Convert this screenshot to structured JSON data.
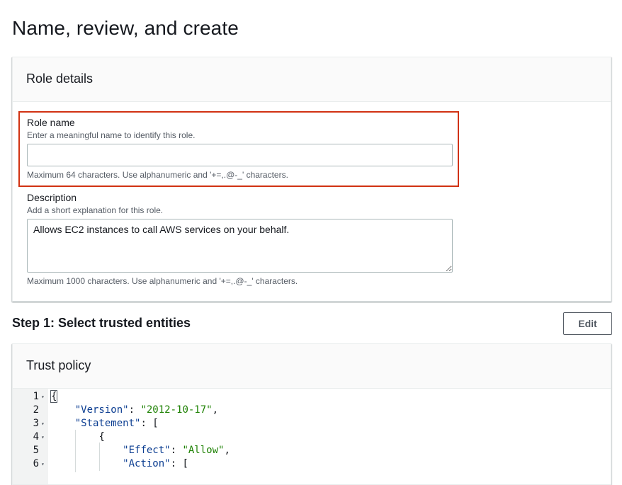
{
  "page": {
    "title": "Name, review, and create"
  },
  "role_details": {
    "header": "Role details",
    "role_name": {
      "label": "Role name",
      "description": "Enter a meaningful name to identify this role.",
      "value": "",
      "constraint": "Maximum 64 characters. Use alphanumeric and '+=,.@-_' characters."
    },
    "description": {
      "label": "Description",
      "description": "Add a short explanation for this role.",
      "value": "Allows EC2 instances to call AWS services on your behalf.",
      "constraint": "Maximum 1000 characters. Use alphanumeric and '+=,.@-_' characters."
    }
  },
  "step1": {
    "title": "Step 1: Select trusted entities",
    "edit_label": "Edit",
    "trust_policy": {
      "header": "Trust policy",
      "lines": [
        {
          "num": "1",
          "foldable": true,
          "text": "{"
        },
        {
          "num": "2",
          "foldable": false,
          "key": "\"Version\"",
          "sep": ": ",
          "val": "\"2012-10-17\"",
          "end": ","
        },
        {
          "num": "3",
          "foldable": true,
          "key": "\"Statement\"",
          "sep": ": ",
          "val": "",
          "end": "["
        },
        {
          "num": "4",
          "foldable": true,
          "text": "{"
        },
        {
          "num": "5",
          "foldable": false,
          "key": "\"Effect\"",
          "sep": ": ",
          "val": "\"Allow\"",
          "end": ","
        },
        {
          "num": "6",
          "foldable": true,
          "key": "\"Action\"",
          "sep": ": ",
          "val": "",
          "end": "["
        }
      ]
    }
  },
  "colors": {
    "highlight": "#d13212",
    "json_key": "#0b3d91",
    "json_string": "#1d8102"
  }
}
